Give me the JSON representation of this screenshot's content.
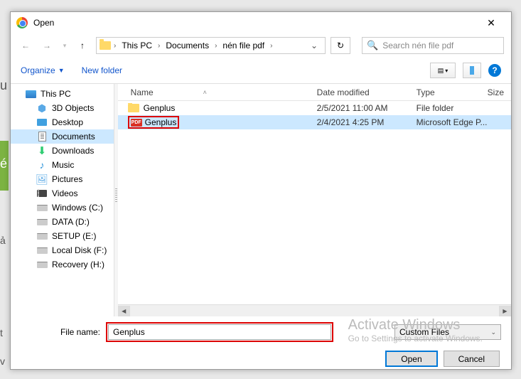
{
  "title": "Open",
  "breadcrumb": [
    "This PC",
    "Documents",
    "nén file pdf"
  ],
  "search_placeholder": "Search nén file pdf",
  "toolbar": {
    "organize": "Organize",
    "newfolder": "New folder"
  },
  "sidebar": {
    "root": "This PC",
    "items": [
      {
        "label": "3D Objects"
      },
      {
        "label": "Desktop"
      },
      {
        "label": "Documents"
      },
      {
        "label": "Downloads"
      },
      {
        "label": "Music"
      },
      {
        "label": "Pictures"
      },
      {
        "label": "Videos"
      },
      {
        "label": "Windows (C:)"
      },
      {
        "label": "DATA (D:)"
      },
      {
        "label": "SETUP (E:)"
      },
      {
        "label": "Local Disk (F:)"
      },
      {
        "label": "Recovery (H:)"
      }
    ]
  },
  "columns": {
    "name": "Name",
    "date": "Date modified",
    "type": "Type",
    "size": "Size"
  },
  "files": [
    {
      "name": "Genplus",
      "date": "2/5/2021 11:00 AM",
      "type": "File folder",
      "kind": "folder"
    },
    {
      "name": "Genplus",
      "date": "2/4/2021 4:25 PM",
      "type": "Microsoft Edge P...",
      "kind": "pdf",
      "selected": true
    }
  ],
  "filename_label": "File name:",
  "filename_value": "Genplus",
  "filetype": "Custom Files",
  "buttons": {
    "open": "Open",
    "cancel": "Cancel"
  },
  "watermark": {
    "line1": "Activate Windows",
    "line2": "Go to Settings to activate Windows."
  }
}
